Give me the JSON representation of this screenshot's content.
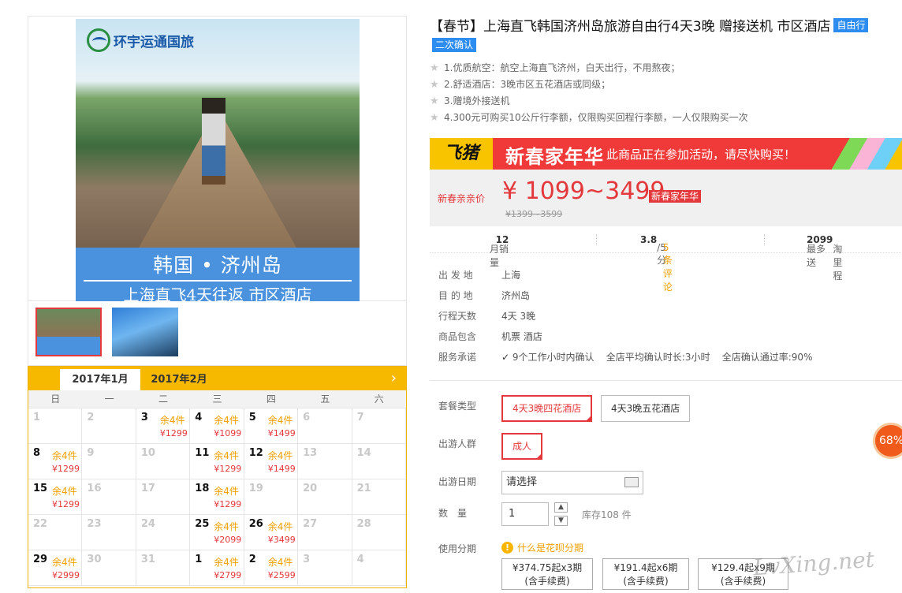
{
  "product": {
    "title": "【春节】上海直飞韩国济州岛旅游自由行4天3晚 赠接送机 市区酒店",
    "tag_type": "自由行",
    "tag_confirm": "二次确认",
    "features": [
      "1.优质航空：航空上海直飞济州，白天出行，不用熬夜；",
      "2.舒适酒店：3晚市区五花酒店或同级；",
      "3.赠境外接送机",
      "4.300元可购买10公斤行李额，仅限购买回程行李额，一人仅限购买一次"
    ]
  },
  "gallery": {
    "brand": "环宇运通国旅",
    "banner_line1": "韩国 • 济州岛",
    "banner_line2": "上海直飞4天往返  市区酒店"
  },
  "promo": {
    "logo": "飞猪",
    "campaign": "新春家年华",
    "message": "此商品正在参加活动，请尽快购买！"
  },
  "price": {
    "label": "新春亲亲价",
    "range": "¥ 1099~3499",
    "badge": "新春家年华",
    "original": "¥1399~3599"
  },
  "stats": {
    "sales_label": "月销量",
    "sales": "12",
    "score": "3.8",
    "score_suffix": "/5分",
    "reviews": "5 条评论",
    "miles_prefix": "最多送",
    "miles": "2099",
    "miles_suffix": "淘里程"
  },
  "info": {
    "departure_label": "出 发 地",
    "departure": "上海",
    "destination_label": "目 的 地",
    "destination": "济州岛",
    "days_label": "行程天数",
    "days": "4天 3晚",
    "includes_label": "商品包含",
    "includes": "机票  酒店",
    "service_label": "服务承诺",
    "service_1": "9个工作小时内确认",
    "service_2": "全店平均确认时长:3小时",
    "service_3": "全店确认通过率:90%"
  },
  "options": {
    "package_label": "套餐类型",
    "package_1": "4天3晚四花酒店",
    "package_2": "4天3晚五花酒店",
    "crowd_label": "出游人群",
    "crowd_1": "成人",
    "date_label": "出游日期",
    "date_placeholder": "请选择",
    "qty_label": "数　量",
    "qty_value": "1",
    "stock": "库存108 件",
    "installment_label": "使用分期",
    "installment_help": "什么是花呗分期",
    "inst_1_amt": "¥374.75起",
    "inst_1_n": "x3期",
    "inst_2_amt": "¥191.4起",
    "inst_2_n": "x6期",
    "inst_3_amt": "¥129.4起",
    "inst_3_n": "x9期",
    "inst_fee": "(含手续费)"
  },
  "calendar": {
    "tab_1": "2017年1月",
    "tab_2": "2017年2月",
    "weekdays": [
      "日",
      "一",
      "二",
      "三",
      "四",
      "五",
      "六"
    ],
    "cells": [
      {
        "d": "1"
      },
      {
        "d": "2"
      },
      {
        "d": "3",
        "s": "余4件",
        "p": "¥1299"
      },
      {
        "d": "4",
        "s": "余4件",
        "p": "¥1099"
      },
      {
        "d": "5",
        "s": "余4件",
        "p": "¥1499"
      },
      {
        "d": "6"
      },
      {
        "d": "7"
      },
      {
        "d": "8",
        "s": "余4件",
        "p": "¥1299"
      },
      {
        "d": "9"
      },
      {
        "d": "10"
      },
      {
        "d": "11",
        "s": "余4件",
        "p": "¥1299"
      },
      {
        "d": "12",
        "s": "余4件",
        "p": "¥1499"
      },
      {
        "d": "13"
      },
      {
        "d": "14"
      },
      {
        "d": "15",
        "s": "余4件",
        "p": "¥1299"
      },
      {
        "d": "16"
      },
      {
        "d": "17"
      },
      {
        "d": "18",
        "s": "余4件",
        "p": "¥1299"
      },
      {
        "d": "19"
      },
      {
        "d": "20"
      },
      {
        "d": "21"
      },
      {
        "d": "22"
      },
      {
        "d": "23"
      },
      {
        "d": "24"
      },
      {
        "d": "25",
        "s": "余4件",
        "p": "¥2099"
      },
      {
        "d": "26",
        "s": "余4件",
        "p": "¥3499"
      },
      {
        "d": "27"
      },
      {
        "d": "28"
      },
      {
        "d": "29",
        "s": "余4件",
        "p": "¥2999"
      },
      {
        "d": "30"
      },
      {
        "d": "31"
      },
      {
        "d": "1",
        "s": "余4件",
        "p": "¥2799"
      },
      {
        "d": "2",
        "s": "余4件",
        "p": "¥2599"
      },
      {
        "d": "3"
      },
      {
        "d": "4"
      }
    ]
  },
  "widgets": {
    "float_percent": "68%",
    "watermark": "LvXing.net"
  }
}
